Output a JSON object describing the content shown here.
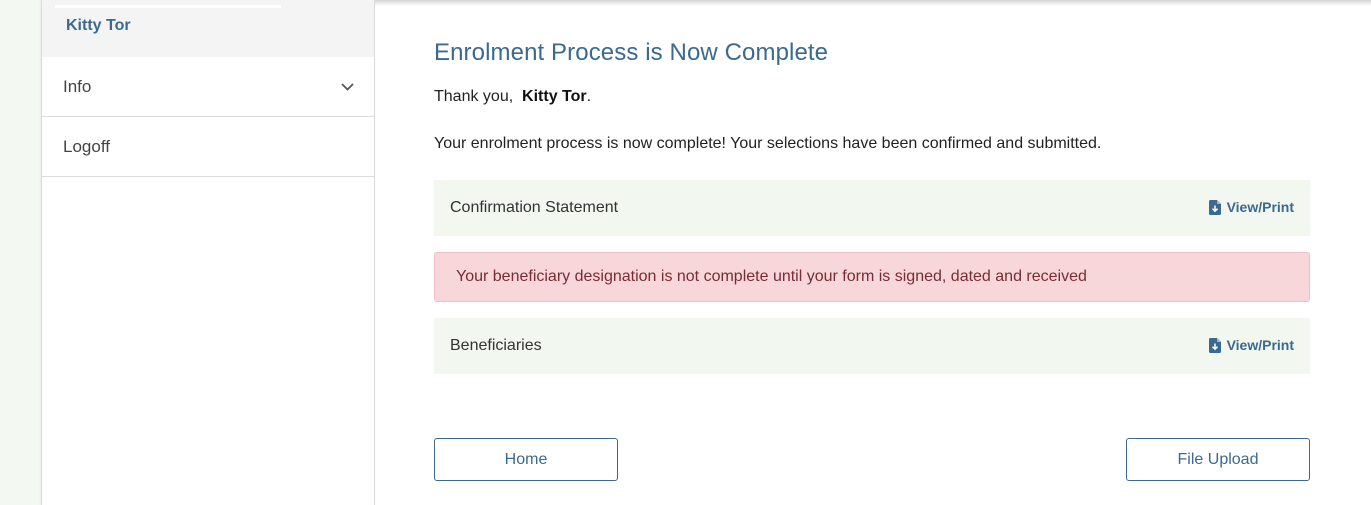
{
  "sidebar": {
    "user_name": "Kitty Tor",
    "items": [
      {
        "label": "Info",
        "icon": "chevron-down-icon"
      },
      {
        "label": "Logoff"
      }
    ]
  },
  "main": {
    "title": "Enrolment Process is Now Complete",
    "thanks_prefix": "Thank you,",
    "thanks_name": "Kitty Tor",
    "thanks_suffix": ".",
    "complete_message": "Your enrolment process is now complete! Your selections have been confirmed and submitted.",
    "documents": [
      {
        "label": "Confirmation Statement",
        "action": "View/Print",
        "icon": "file-download-icon"
      },
      {
        "label": "Beneficiaries",
        "action": "View/Print",
        "icon": "file-download-icon"
      }
    ],
    "alert": "Your beneficiary designation is not complete until your form is signed, dated and received",
    "buttons": {
      "home": "Home",
      "file_upload": "File Upload"
    }
  },
  "colors": {
    "accent": "#3b6a8e",
    "alert_bg": "#f7d7da",
    "alert_text": "#7a2b34",
    "row_bg": "#f2f7f0",
    "page_bg": "#f3f8f2"
  }
}
